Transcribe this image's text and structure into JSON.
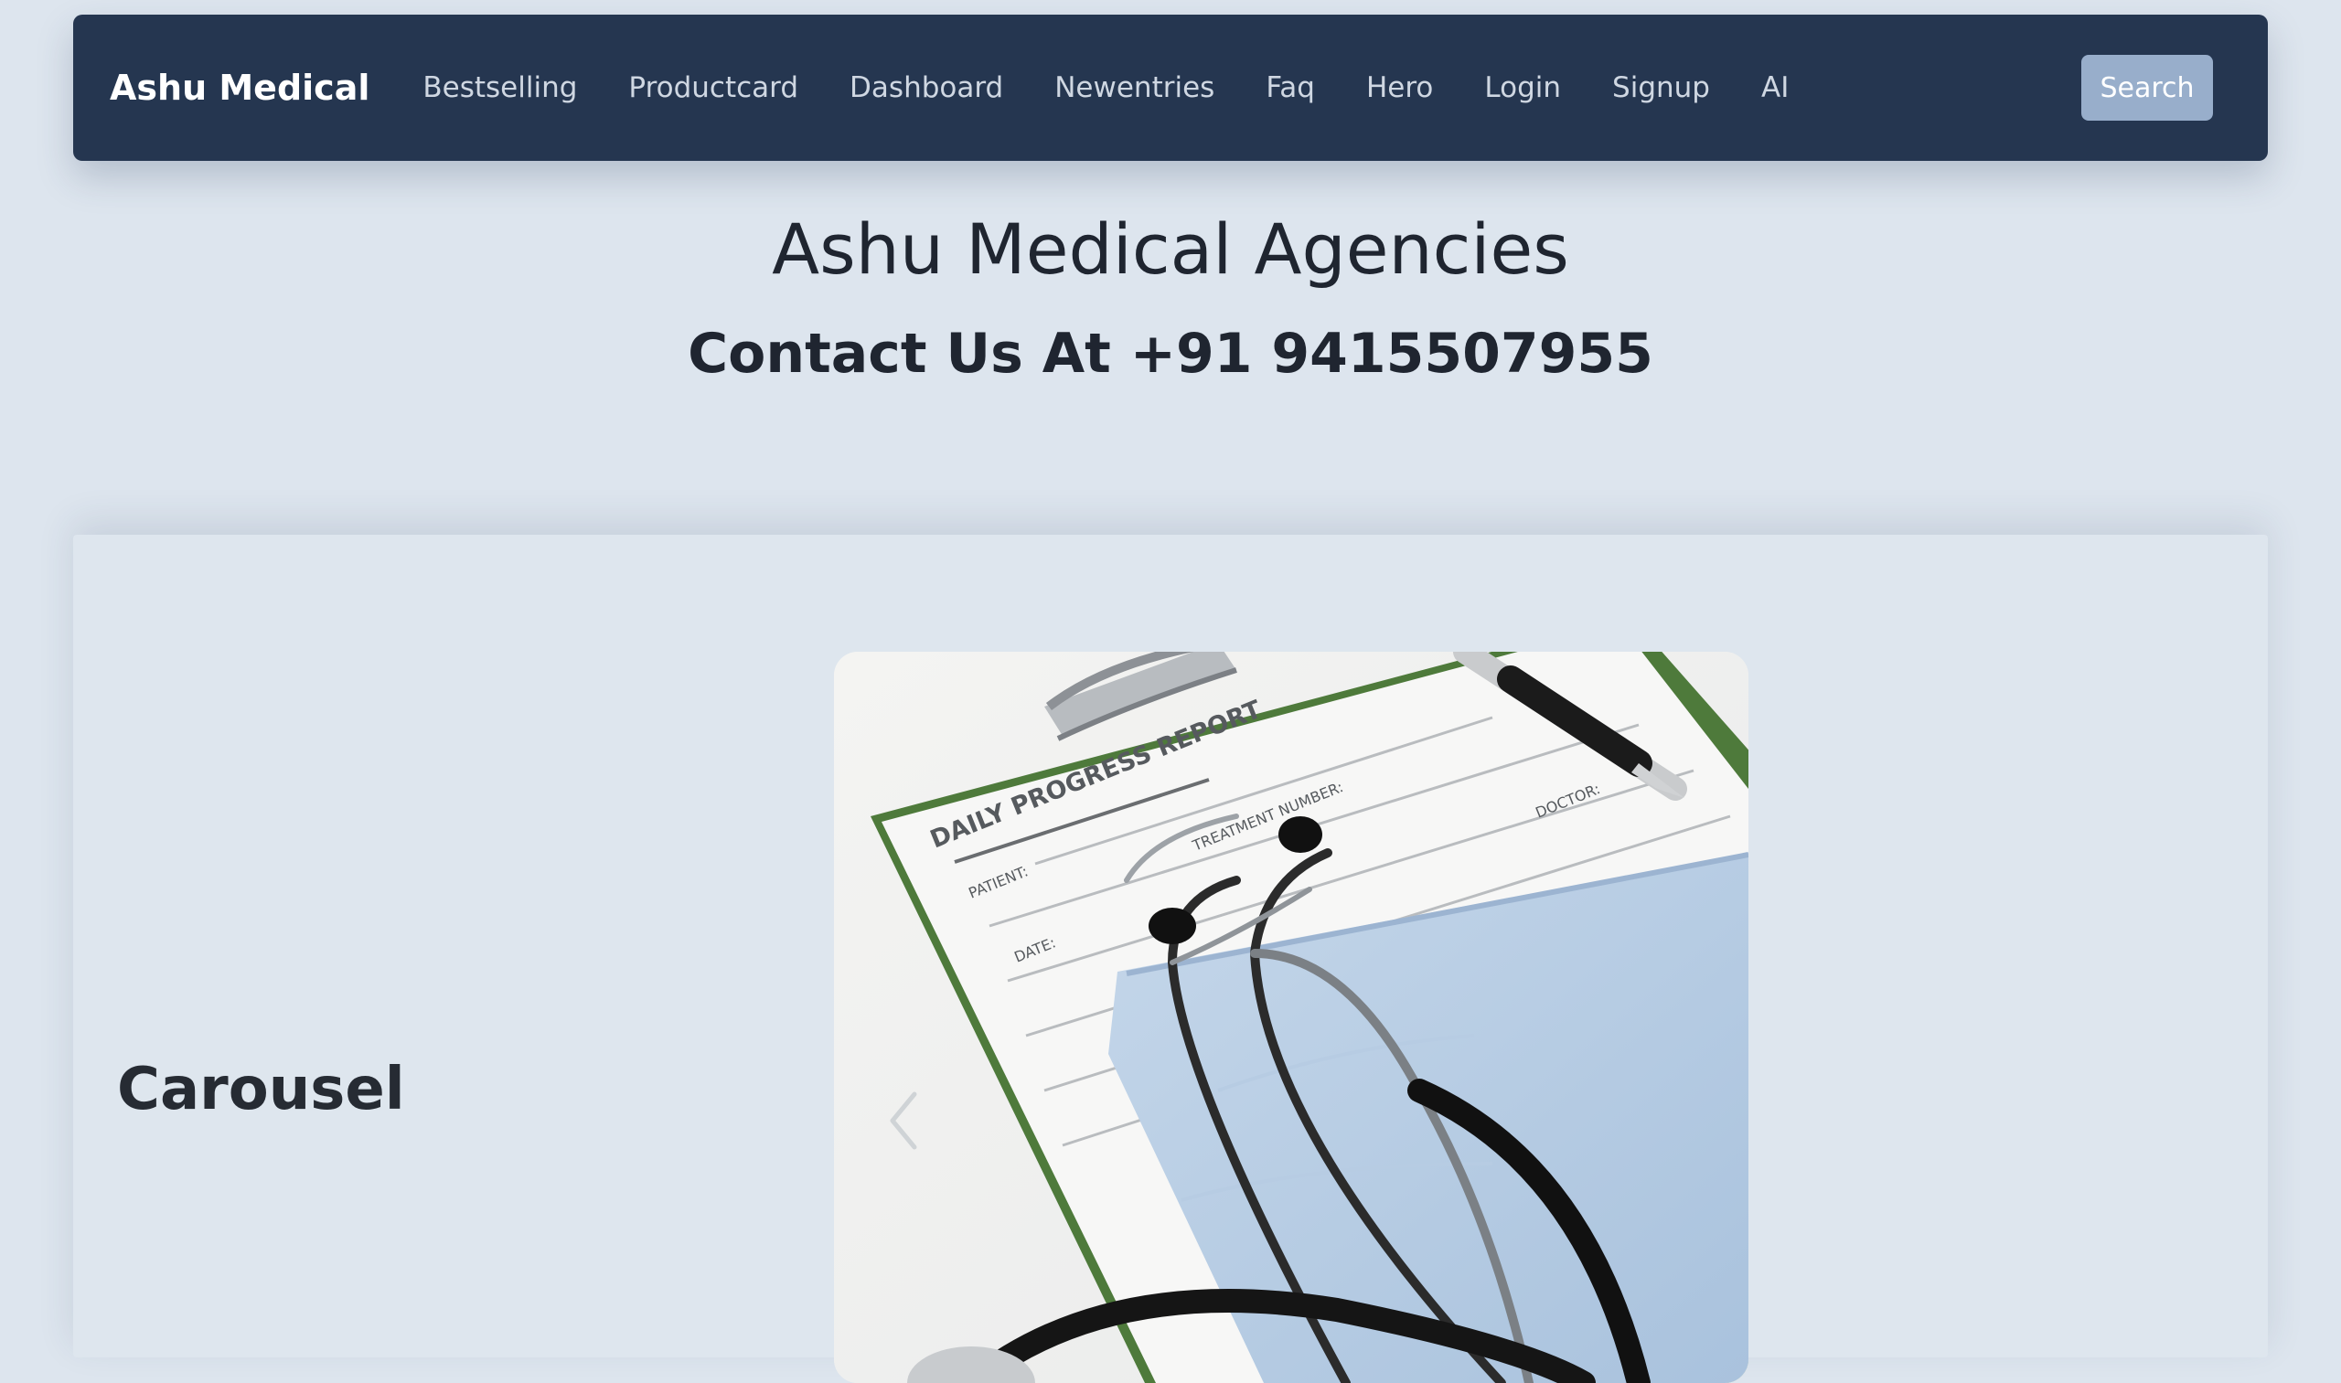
{
  "navbar": {
    "brand": "Ashu Medical",
    "links": [
      "Bestselling",
      "Productcard",
      "Dashboard",
      "Newentries",
      "Faq",
      "Hero",
      "Login",
      "Signup",
      "AI"
    ],
    "search_label": "Search"
  },
  "hero": {
    "title": "Ashu Medical Agencies",
    "subtitle": "Contact Us At +91 9415507955"
  },
  "carousel": {
    "heading": "Carousel",
    "image_text": {
      "report_title": "DAILY PROGRESS REPORT",
      "patient_label": "PATIENT:",
      "treatment_label": "TREATMENT NUMBER:",
      "doctor_label": "DOCTOR:",
      "date_label": "DATE:"
    }
  },
  "colors": {
    "page_bg": "#dde5ee",
    "navbar_bg": "#253650",
    "search_bg": "#98aecb"
  }
}
